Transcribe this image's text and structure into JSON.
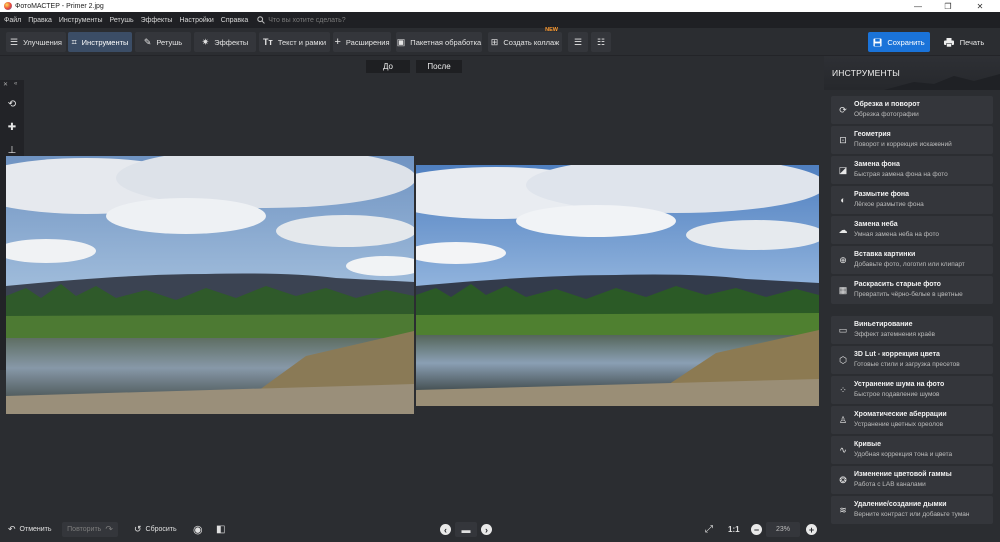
{
  "window": {
    "title": "ФотоМАСТЕР - Primer 2.jpg",
    "minimize": "—",
    "maximize": "❐",
    "close": "✕"
  },
  "menu": {
    "items": [
      "Файл",
      "Правка",
      "Инструменты",
      "Ретушь",
      "Эффекты",
      "Настройки",
      "Справка"
    ],
    "search_placeholder": "Что вы хотите сделать?"
  },
  "toolbar": {
    "tabs": [
      {
        "label": "Улучшения",
        "icon": "sliders-icon"
      },
      {
        "label": "Инструменты",
        "icon": "crop-icon",
        "active": true
      },
      {
        "label": "Ретушь",
        "icon": "brush-icon"
      },
      {
        "label": "Эффекты",
        "icon": "sparkle-icon"
      },
      {
        "label": "Текст и рамки",
        "icon": "text-icon"
      },
      {
        "label": "Расширения",
        "icon": "plus-icon"
      }
    ],
    "batch": "Пакетная обработка",
    "collage": "Создать коллаж",
    "new_badge": "NEW",
    "save": "Сохранить",
    "print": "Печать"
  },
  "view": {
    "before": "До",
    "after": "После"
  },
  "panel": {
    "title": "ИНСТРУМЕНТЫ",
    "group1": [
      {
        "title": "Обрезка и поворот",
        "sub": "Обрезка фотографии",
        "icon": "crop-rotate-icon"
      },
      {
        "title": "Геометрия",
        "sub": "Поворот и коррекция искажений",
        "icon": "geometry-icon"
      },
      {
        "title": "Замена фона",
        "sub": "Быстрая замена фона на фото",
        "icon": "background-replace-icon"
      },
      {
        "title": "Размытие фона",
        "sub": "Лёгкое размытие фона",
        "icon": "blur-icon"
      },
      {
        "title": "Замена неба",
        "sub": "Умная замена неба на фото",
        "icon": "sky-icon"
      },
      {
        "title": "Вставка картинки",
        "sub": "Добавьте фото, логотип или клипарт",
        "icon": "insert-image-icon"
      },
      {
        "title": "Раскрасить старые фото",
        "sub": "Превратить чёрно-белые в цветные",
        "icon": "colorize-icon"
      }
    ],
    "group2": [
      {
        "title": "Виньетирование",
        "sub": "Эффект затемнения краёв",
        "icon": "vignette-icon"
      },
      {
        "title": "3D Lut - коррекция цвета",
        "sub": "Готовые стили и загрузка пресетов",
        "icon": "lut-cube-icon"
      },
      {
        "title": "Устранение шума на фото",
        "sub": "Быстрое подавление шумов",
        "icon": "denoise-icon"
      },
      {
        "title": "Хроматические аберрации",
        "sub": "Устранение цветных ореолов",
        "icon": "chromatic-icon"
      },
      {
        "title": "Кривые",
        "sub": "Удобная коррекция тона и цвета",
        "icon": "curves-icon"
      },
      {
        "title": "Изменение цветовой гаммы",
        "sub": "Работа с LAB каналами",
        "icon": "color-wheel-icon"
      },
      {
        "title": "Удаление/создание дымки",
        "sub": "Верните контраст или добавьте туман",
        "icon": "haze-icon"
      }
    ]
  },
  "bottom": {
    "undo": "Отменить",
    "redo": "Повторить",
    "reset": "Сбросить",
    "ratio": "1:1",
    "zoom": "23%"
  },
  "colors": {
    "accent": "#1a73d9",
    "new_badge": "#ff9a2e",
    "active_tab": "#3b4d66"
  }
}
